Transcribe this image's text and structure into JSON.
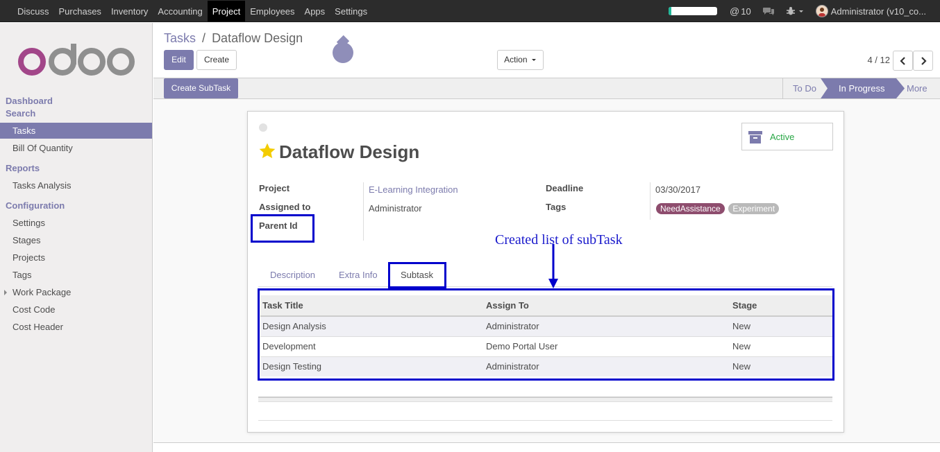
{
  "topbar": {
    "menu": [
      "Discuss",
      "Purchases",
      "Inventory",
      "Accounting",
      "Project",
      "Employees",
      "Apps",
      "Settings"
    ],
    "active_menu": "Project",
    "progress_fraction": 0.06,
    "mentions_count": "10",
    "user_label": "Administrator (v10_co..."
  },
  "sidebar": {
    "logo_text": "odoo",
    "dashboard": "Dashboard",
    "search": "Search",
    "tasks": "Tasks",
    "bill_of_quantity": "Bill Of Quantity",
    "reports": "Reports",
    "tasks_analysis": "Tasks Analysis",
    "configuration": "Configuration",
    "settings": "Settings",
    "stages": "Stages",
    "projects": "Projects",
    "tags": "Tags",
    "work_package": "Work Package",
    "cost_code": "Cost Code",
    "cost_header": "Cost Header"
  },
  "control_panel": {
    "breadcrumb_link": "Tasks",
    "breadcrumb_sep": "/",
    "breadcrumb_current": "Dataflow Design",
    "edit": "Edit",
    "create": "Create",
    "action": "Action",
    "pager": "4 / 12"
  },
  "statusbar": {
    "create_subtask": "Create SubTask",
    "stages": [
      "To Do",
      "In Progress",
      "More"
    ],
    "active_stage": "In Progress"
  },
  "form": {
    "title": "Dataflow Design",
    "active_label": "Active",
    "project_label": "Project",
    "project_value": "E-Learning Integration",
    "assigned_label": "Assigned to",
    "assigned_value": "Administrator",
    "parent_label": "Parent Id",
    "deadline_label": "Deadline",
    "deadline_value": "03/30/2017",
    "tags_label": "Tags",
    "tags": [
      {
        "name": "NeedAssistance",
        "color": "#8e4d6e"
      },
      {
        "name": "Experiment",
        "color": "#b9b9b9"
      }
    ],
    "tabs": [
      "Description",
      "Extra Info",
      "Subtask"
    ],
    "active_tab": "Subtask"
  },
  "subtask_table": {
    "columns": [
      "Task Title",
      "Assign To",
      "Stage"
    ],
    "rows": [
      [
        "Design Analysis",
        "Administrator",
        "New"
      ],
      [
        "Development",
        "Demo Portal User",
        "New"
      ],
      [
        "Design Testing",
        "Administrator",
        "New"
      ]
    ]
  },
  "annotation": {
    "text": "Created list of subTask",
    "color": "#0000cc"
  }
}
